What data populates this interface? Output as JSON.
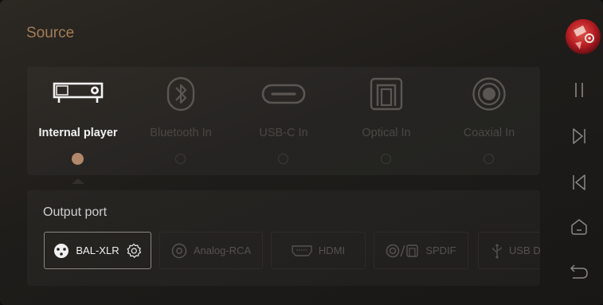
{
  "header": {
    "title": "Source"
  },
  "sources": [
    {
      "label": "Internal player",
      "icon": "internal-player-icon",
      "active": true
    },
    {
      "label": "Bluetooth In",
      "icon": "bluetooth-icon",
      "active": false
    },
    {
      "label": "USB-C In",
      "icon": "usb-c-icon",
      "active": false
    },
    {
      "label": "Optical In",
      "icon": "optical-icon",
      "active": false
    },
    {
      "label": "Coaxial In",
      "icon": "coaxial-icon",
      "active": false
    }
  ],
  "output": {
    "title": "Output port",
    "ports": [
      {
        "label": "BAL-XLR",
        "icon": "xlr-icon",
        "selected": true,
        "settings_icon": "gear-icon"
      },
      {
        "label": "Analog-RCA",
        "icon": "rca-icon",
        "selected": false
      },
      {
        "label": "HDMI",
        "icon": "hdmi-icon",
        "selected": false
      },
      {
        "label": "SPDIF",
        "icon": "spdif-icon",
        "selected": false
      },
      {
        "label": "USB D",
        "icon": "usb-icon",
        "selected": false
      }
    ]
  },
  "sidebar": {
    "avatar": "album-art-avatar",
    "controls": [
      "pause-icon",
      "next-track-icon",
      "previous-track-icon",
      "home-icon",
      "back-icon"
    ]
  },
  "colors": {
    "accent": "#a37d58",
    "radio_active": "#b18869",
    "text_active": "#f1f1f1",
    "text_inactive": "#4b4843",
    "background": "#211f1c"
  }
}
